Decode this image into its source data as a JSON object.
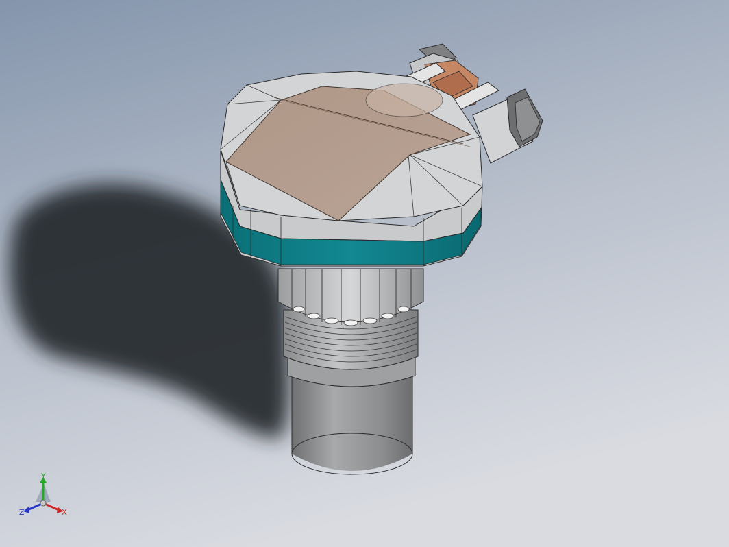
{
  "viewport": {
    "background_top": "#8596ad",
    "background_bottom": "#d6d9e0"
  },
  "triad": {
    "x_label": "X",
    "y_label": "Y",
    "z_label": "Z",
    "x_color": "#cc2a2a",
    "y_color": "#27a82a",
    "z_color": "#2a3acc"
  },
  "model": {
    "accent_band_color": "#0f7f86",
    "lid_tint": "#b08d78",
    "body_color": "#c9cacb"
  }
}
